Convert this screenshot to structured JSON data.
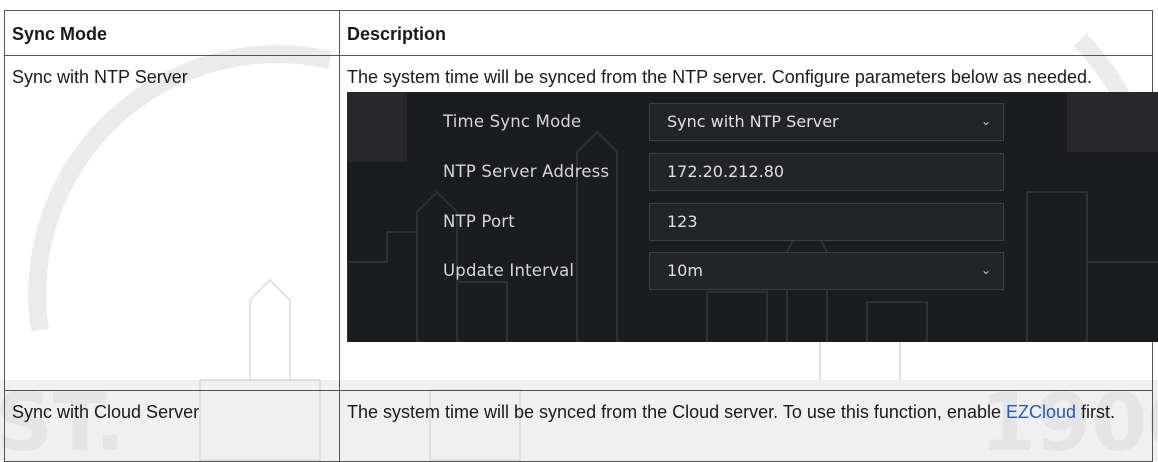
{
  "table": {
    "headers": [
      "Sync Mode",
      "Description"
    ],
    "rows": [
      {
        "mode": "Sync with NTP Server",
        "description": "The system time will be synced from the NTP server. Configure parameters below as needed."
      },
      {
        "mode": "Sync with Cloud Server",
        "description_before": "The system time will be synced from the Cloud server. To use this function, enable ",
        "description_link": "EZCloud",
        "description_after": " first."
      }
    ]
  },
  "panel": {
    "fields": [
      {
        "label": "Time Sync Mode",
        "value": "Sync with NTP Server",
        "type": "select"
      },
      {
        "label": "NTP Server Address",
        "value": "172.20.212.80",
        "type": "input"
      },
      {
        "label": "NTP Port",
        "value": "123",
        "type": "input"
      },
      {
        "label": "Update Interval",
        "value": "10m",
        "type": "select"
      }
    ]
  },
  "icons": {
    "dropdown": "chevron-down-icon"
  },
  "colors": {
    "link": "#1a5bd6",
    "panel_bg": "#1b1c1f",
    "border": "#555555"
  }
}
